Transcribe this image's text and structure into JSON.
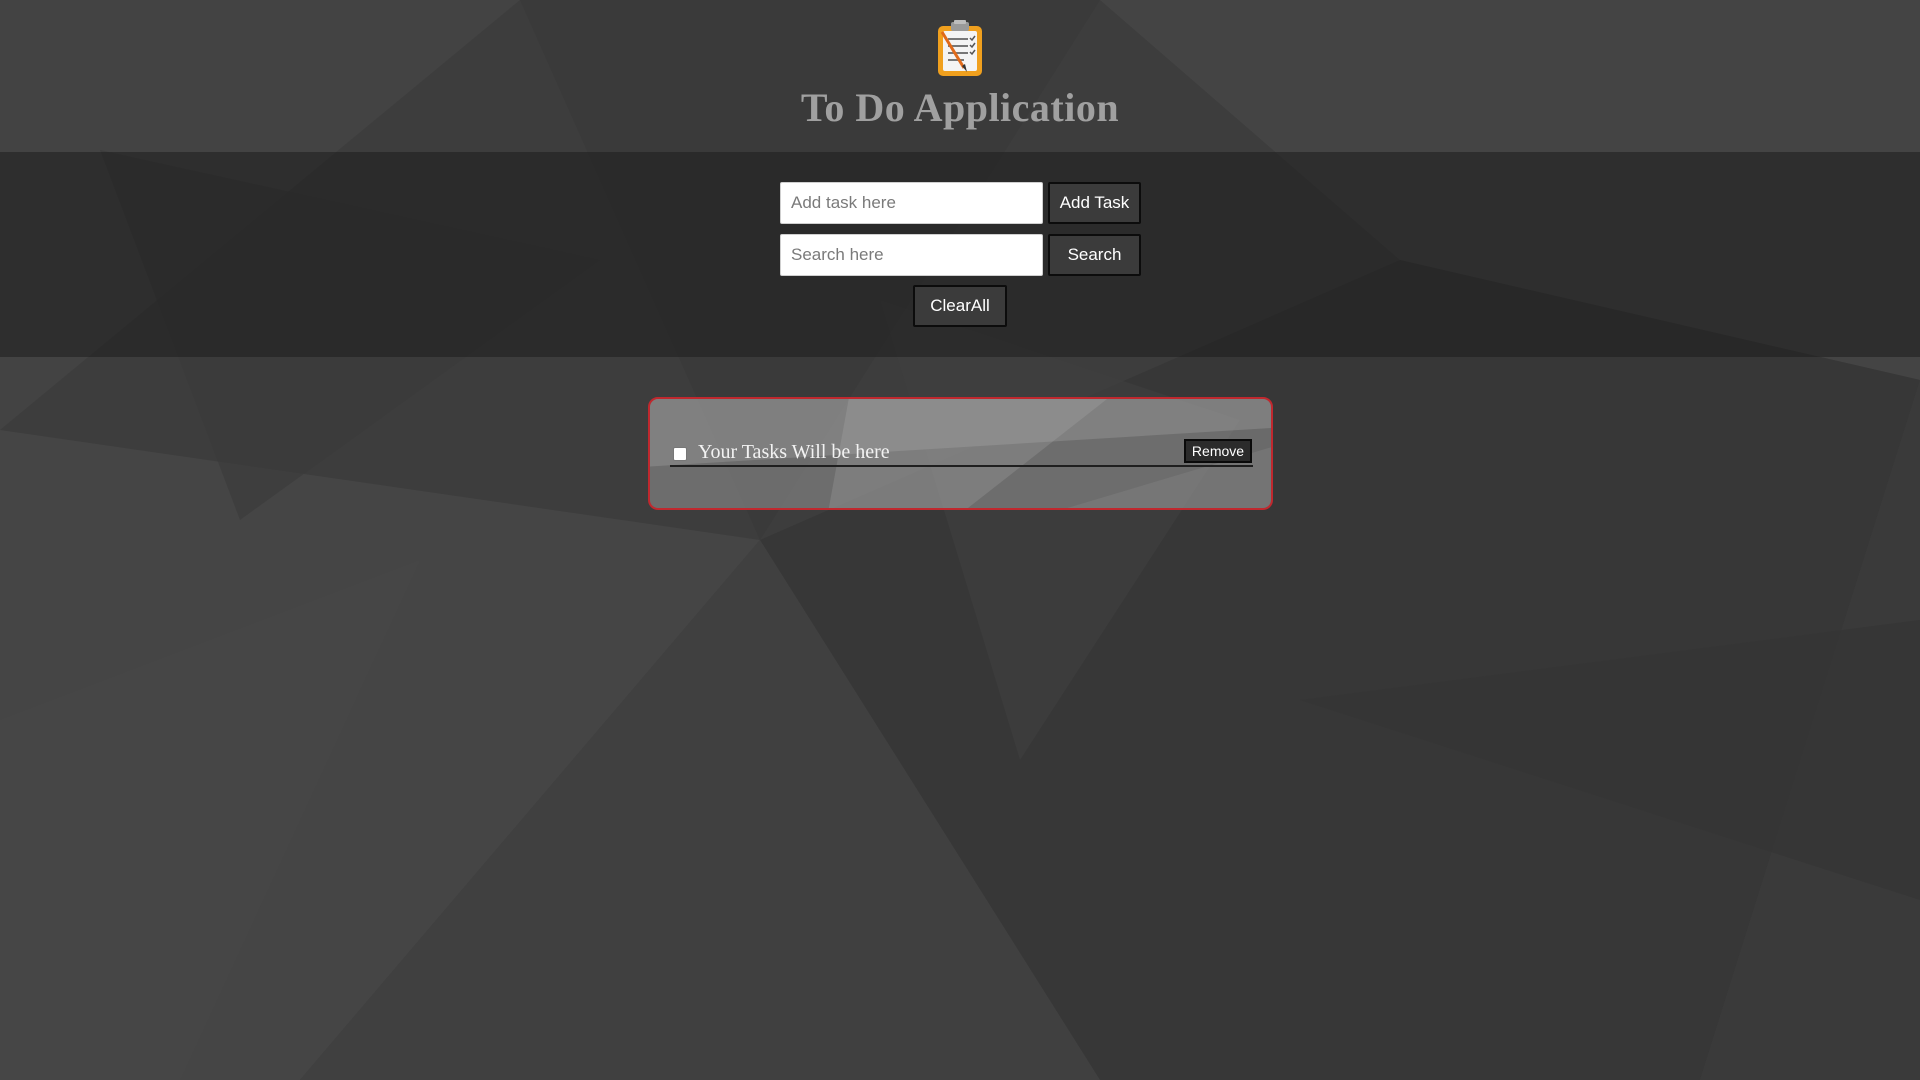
{
  "app": {
    "title": "To Do Application",
    "logo_icon": "clipboard-checklist-icon"
  },
  "controls": {
    "add_task_input": {
      "placeholder": "Add task here",
      "value": ""
    },
    "add_task_label": "Add Task",
    "search_input": {
      "placeholder": "Search here",
      "value": ""
    },
    "search_label": "Search",
    "clear_all_label": "ClearAll"
  },
  "tasks": [
    {
      "text": "Your Tasks Will be here",
      "checked": false,
      "remove_label": "Remove"
    }
  ],
  "colors": {
    "background": "#3e3e3e",
    "title": "#a0a0a0",
    "card_border": "#c0282e",
    "button": "#3b3b3b",
    "logo_accent": "#f0a01e"
  }
}
